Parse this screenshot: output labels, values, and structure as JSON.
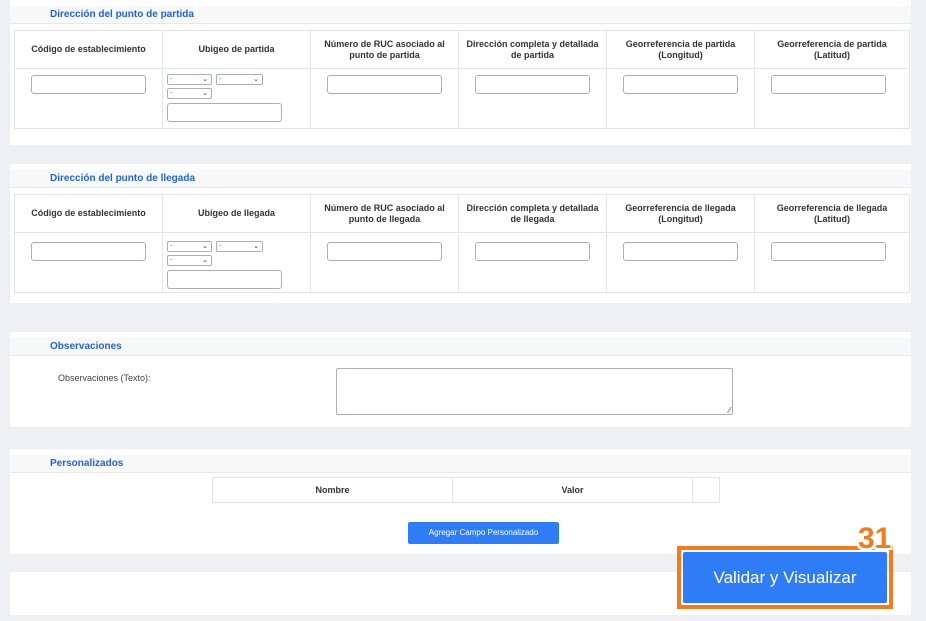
{
  "partida": {
    "title": "Dirección del punto de partida",
    "columns": [
      "Código de establecimiento",
      "Ubigeo de partida",
      "Número de RUC asociado al punto de partida",
      "Dirección completa y detallada de partida",
      "Georreferencia de partida (Longitud)",
      "Georreferencia de partida (Latitud)"
    ],
    "select_placeholder": "-"
  },
  "llegada": {
    "title": "Dirección del punto de llegada",
    "columns": [
      "Código de establecimiento",
      "Ubigeo de llegada",
      "Número de RUC asociado al punto de llegada",
      "Dirección completa y detallada de llegada",
      "Georreferencia de llegada (Longitud)",
      "Georreferencia de llegada (Latitud)"
    ],
    "select_placeholder": "-"
  },
  "observaciones": {
    "title": "Observaciones",
    "label": "Observaciones (Texto):"
  },
  "personalizados": {
    "title": "Personalizados",
    "col_nombre": "Nombre",
    "col_valor": "Valor",
    "add_button": "Agregar Campo Personalizado"
  },
  "footer": {
    "submit_button": "Validar y Visualizar",
    "step_badge": "31"
  },
  "colors": {
    "accent": "#2f7df6",
    "title_blue": "#2563cf",
    "highlight_orange": "#f27a21"
  }
}
